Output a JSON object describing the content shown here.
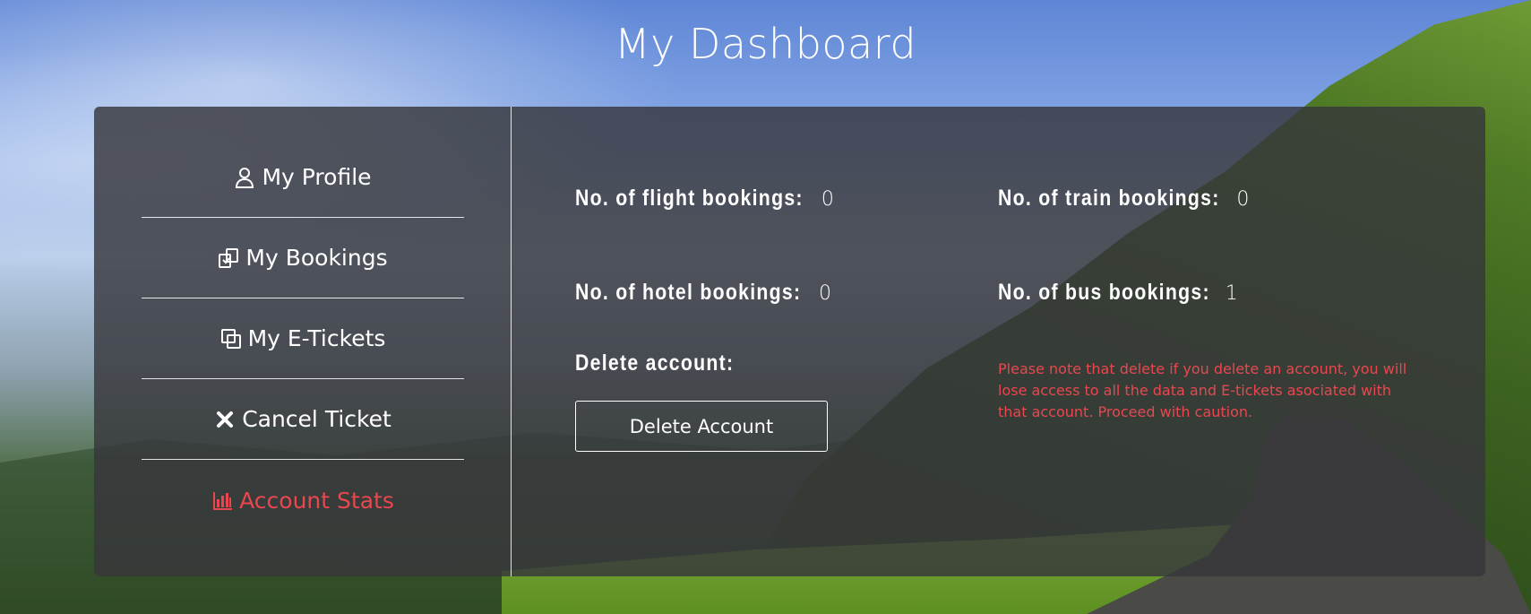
{
  "page": {
    "title": "My Dashboard"
  },
  "sidebar": {
    "items": [
      {
        "label": "My Profile",
        "icon": "user-icon"
      },
      {
        "label": "My Bookings",
        "icon": "bookings-icon"
      },
      {
        "label": "My E-Tickets",
        "icon": "copy-icon"
      },
      {
        "label": "Cancel Ticket",
        "icon": "close-icon"
      },
      {
        "label": "Account Stats",
        "icon": "bar-chart-icon",
        "active": true
      }
    ]
  },
  "stats": {
    "flight": {
      "label": "No. of flight bookings:",
      "value": "0"
    },
    "train": {
      "label": "No. of train bookings:",
      "value": "0"
    },
    "hotel": {
      "label": "No. of hotel bookings:",
      "value": "0"
    },
    "bus": {
      "label": "No. of bus bookings:",
      "value": "1"
    }
  },
  "delete": {
    "heading": "Delete account:",
    "button_label": "Delete Account",
    "warning": "Please note that delete if you delete an account, you will lose access to all the data and E-tickets asociated with that account. Proceed with caution."
  },
  "colors": {
    "accent": "#e8474f",
    "panel": "rgba(55,55,60,0.82)"
  }
}
